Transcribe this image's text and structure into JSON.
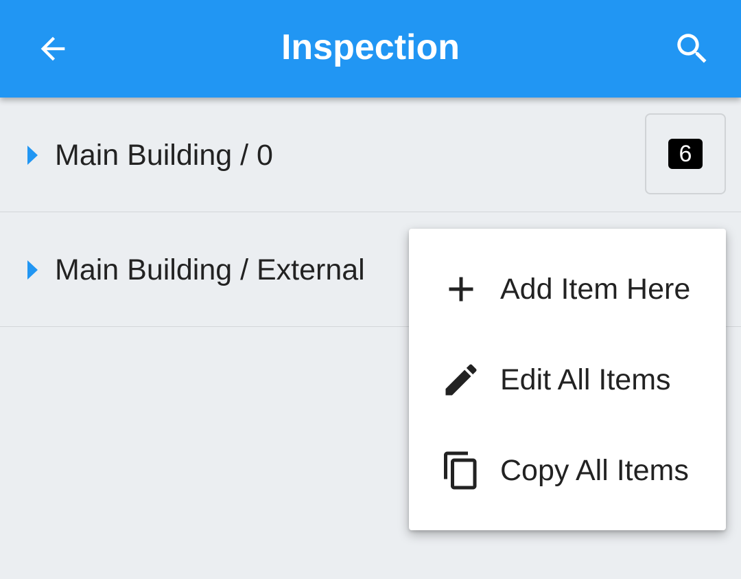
{
  "app_bar": {
    "title": "Inspection",
    "background_color": "#2196f3",
    "back_icon": "arrow-back-icon",
    "search_icon": "search-icon"
  },
  "list": {
    "rows": [
      {
        "label": "Main Building / 0",
        "expand_icon": "caret-right-icon",
        "count": "6"
      },
      {
        "label": "Main Building / External",
        "expand_icon": "caret-right-icon"
      }
    ]
  },
  "context_menu": {
    "items": [
      {
        "label": "Add Item Here",
        "icon": "plus-icon"
      },
      {
        "label": "Edit All Items",
        "icon": "pencil-icon"
      },
      {
        "label": "Copy All Items",
        "icon": "copy-icon"
      }
    ]
  }
}
